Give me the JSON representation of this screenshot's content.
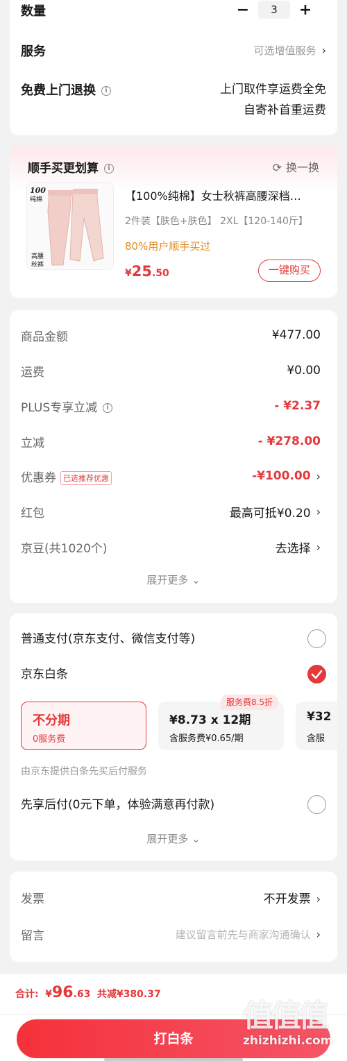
{
  "order": {
    "quantity_label": "数量",
    "quantity_value": "3",
    "service_label": "服务",
    "service_value": "可选增值服务",
    "return_label": "免费上门退换",
    "return_line1": "上门取件享运费全免",
    "return_line2": "自寄补首重运费"
  },
  "addon": {
    "title": "顺手买更划算",
    "refresh_label": "换一换",
    "product_title": "【100%纯棉】女士秋裤高腰深档…",
    "product_spec": "2件装【肤色+肤色】 2XL【120-140斤】",
    "promo": "80%用户顺手买过",
    "price_symbol": "¥",
    "price_int": "25",
    "price_dec": ".50",
    "buy_label": "一键购买",
    "image_text_top": "100",
    "image_text_sub": "纯棉",
    "image_text_bottom": "高腰\n秋裤"
  },
  "pricing": {
    "rows": [
      {
        "label": "商品金额",
        "value": "¥477.00"
      },
      {
        "label": "运费",
        "value": "¥0.00"
      },
      {
        "label": "PLUS专享立减",
        "value": "- ¥2.37"
      },
      {
        "label": "立减",
        "value": "- ¥278.00"
      },
      {
        "label": "优惠券",
        "tag": "已选推荐优惠",
        "value": "-¥100.00"
      },
      {
        "label": "红包",
        "value": "最高可抵¥0.20"
      },
      {
        "label": "京豆(共1020个)",
        "value": "去选择"
      }
    ],
    "expand_label": "展开更多"
  },
  "payment": {
    "normal_label": "普通支付(京东支付、微信支付等)",
    "baitiao_label": "京东白条",
    "plans": [
      {
        "title": "不分期",
        "sub": "0服务费"
      },
      {
        "title": "¥8.73 x 12期",
        "sub": "含服务费¥0.65/期"
      },
      {
        "title": "¥32",
        "sub": "含服"
      }
    ],
    "service_badge": "服务费8.5折",
    "provider_note": "由京东提供白条先买后付服务",
    "later_label": "先享后付(0元下单，体验满意再付款)",
    "expand_label": "展开更多"
  },
  "extra": {
    "invoice_label": "发票",
    "invoice_value": "不开发票",
    "message_label": "留言",
    "message_placeholder": "建议留言前先与商家沟通确认"
  },
  "footer": {
    "total_label": "合计:",
    "total_symbol": "¥",
    "total_int": "96",
    "total_dec": ".63",
    "saved": "共减¥380.37",
    "pay_button": "打白条"
  },
  "watermark": {
    "text": "值",
    "domain": "zhizhizhi.com"
  },
  "colors": {
    "accent": "#e4393c",
    "promo": "#e08a1e"
  }
}
